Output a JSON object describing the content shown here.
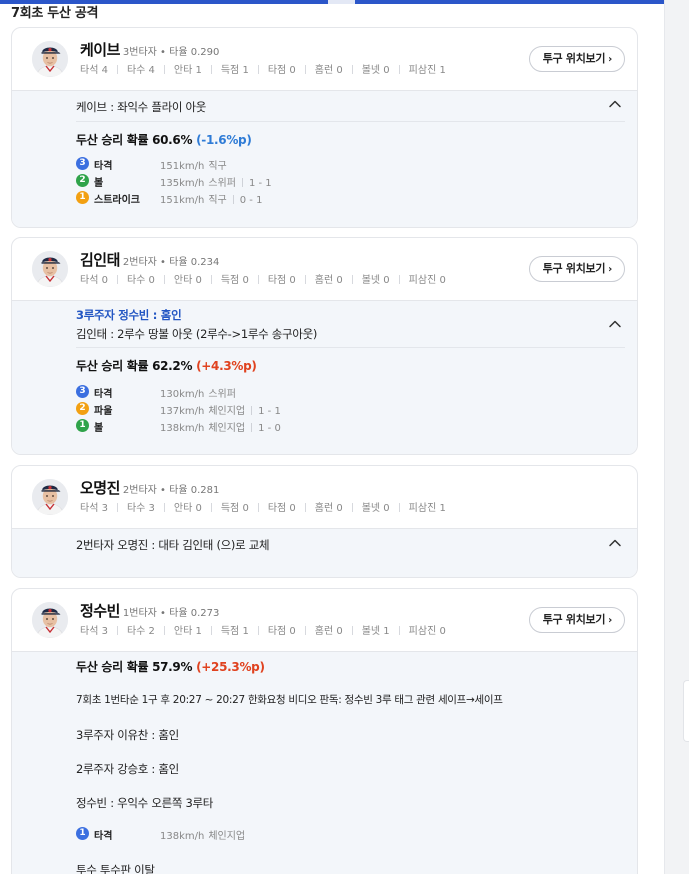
{
  "section_title": "7회초 두산 공격",
  "colors": {
    "accent": "#2b56c9",
    "blue_delta": "#2e7bd6",
    "red_delta": "#e0421f",
    "runner": "#2356c3"
  },
  "pitch_button_label": "투구 위치보기",
  "cards": [
    {
      "name": "케이브",
      "info": "3번타자 • 타율 0.290",
      "stats": [
        "타석 4",
        "타수 4",
        "안타 1",
        "득점 1",
        "타점 0",
        "홈런 0",
        "볼넷 0",
        "피삼진 1"
      ],
      "result": "케이브 : 좌익수 플라이 아웃",
      "prob_label": "두산 승리 확률 60.6%",
      "prob_delta": "(-1.6%p)",
      "pitches": [
        {
          "num": "3",
          "type": "타격",
          "speed": "151km/h",
          "kind": "직구",
          "count": ""
        },
        {
          "num": "2",
          "type": "볼",
          "speed": "135km/h",
          "kind": "스위퍼",
          "count": "1 - 1"
        },
        {
          "num": "1",
          "type": "스트라이크",
          "speed": "151km/h",
          "kind": "직구",
          "count": "0 - 1"
        }
      ]
    },
    {
      "name": "김인태",
      "info": "2번타자 • 타율 0.234",
      "stats": [
        "타석 0",
        "타수 0",
        "안타 0",
        "득점 0",
        "타점 0",
        "홈런 0",
        "볼넷 0",
        "피삼진 0"
      ],
      "runner": "3루주자 정수빈 : 홈인",
      "result": "김인태 : 2루수 땅볼 아웃 (2루수->1루수 송구아웃)",
      "prob_label": "두산 승리 확률 62.2%",
      "prob_delta": "(+4.3%p)",
      "pitches": [
        {
          "num": "3",
          "type": "타격",
          "speed": "130km/h",
          "kind": "스위퍼",
          "count": ""
        },
        {
          "num": "2",
          "type": "파울",
          "speed": "137km/h",
          "kind": "체인지업",
          "count": "1 - 1"
        },
        {
          "num": "1",
          "type": "볼",
          "speed": "138km/h",
          "kind": "체인지업",
          "count": "1 - 0"
        }
      ]
    },
    {
      "name": "오명진",
      "info": "2번타자 • 타율 0.281",
      "stats": [
        "타석 3",
        "타수 3",
        "안타 0",
        "득점 0",
        "타점 0",
        "홈런 0",
        "볼넷 0",
        "피삼진 1"
      ],
      "result": "2번타자 오명진 : 대타 김인태 (으)로 교체"
    },
    {
      "name": "정수빈",
      "info": "1번타자 • 타율 0.273",
      "stats": [
        "타석 3",
        "타수 2",
        "안타 1",
        "득점 1",
        "타점 0",
        "홈런 0",
        "볼넷 1",
        "피삼진 0"
      ],
      "prob_label": "두산 승리 확률 57.9%",
      "prob_delta": "(+25.3%p)",
      "lines": [
        "7회초 1번타순 1구 후 20:27 ~ 20:27 한화요청 비디오 판독: 정수빈 3루 태그 관련 세이프→세이프",
        "3루주자 이유찬 : 홈인",
        "2루주자 강승호 : 홈인",
        "정수빈 : 우익수 오른쪽 3루타"
      ],
      "pitches": [
        {
          "num": "1",
          "type": "타격",
          "speed": "138km/h",
          "kind": "체인지업",
          "count": ""
        }
      ],
      "last_line": "투수 투수판 이탈"
    }
  ]
}
